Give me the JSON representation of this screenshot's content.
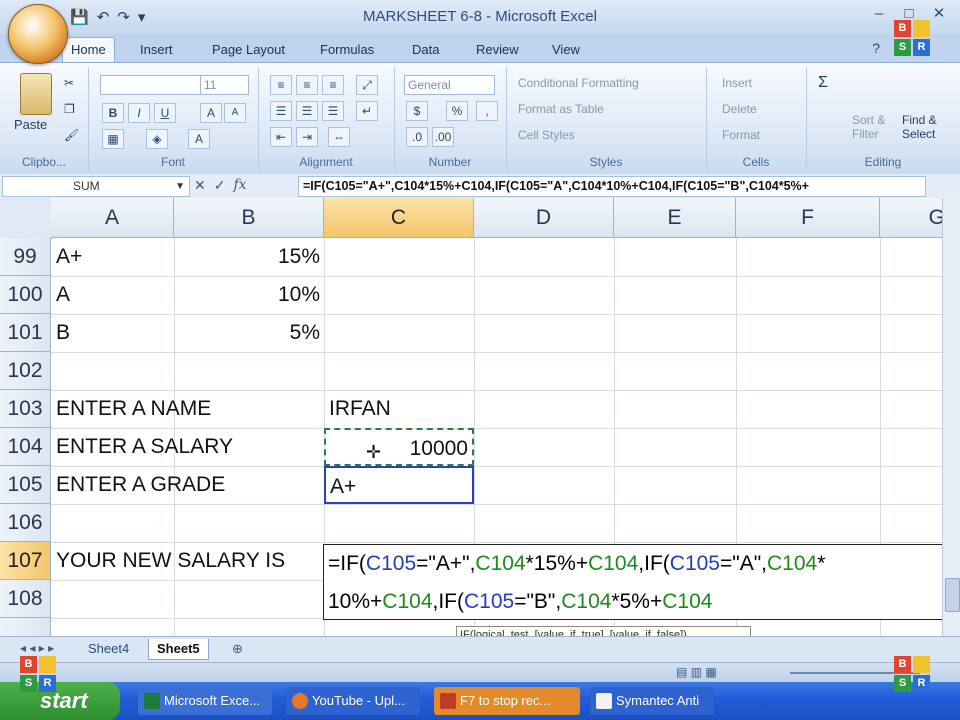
{
  "window": {
    "title": "MARKSHEET 6-8 - Microsoft Excel"
  },
  "ribbon_tabs": [
    "Home",
    "Insert",
    "Page Layout",
    "Formulas",
    "Data",
    "Review",
    "View"
  ],
  "ribbon": {
    "clipboard": {
      "paste_label": "Paste",
      "group_label": "Clipbo..."
    },
    "font": {
      "size": "11",
      "group_label": "Font"
    },
    "alignment": {
      "group_label": "Alignment"
    },
    "number": {
      "format": "General",
      "dollar": "$",
      "percent": "%",
      "comma": ",",
      "group_label": "Number"
    },
    "styles": {
      "conditional": "Conditional Formatting",
      "format_table": "Format as Table",
      "cell_styles": "Cell Styles",
      "group_label": "Styles"
    },
    "cells": {
      "insert": "Insert",
      "delete": "Delete",
      "format": "Format",
      "group_label": "Cells"
    },
    "editing": {
      "sigma": "Σ",
      "sort": "Sort & Filter",
      "find": "Find & Select",
      "group_label": "Editing"
    }
  },
  "formula_bar": {
    "name_box": "SUM",
    "formula": "=IF(C105=\"A+\",C104*15%+C104,IF(C105=\"A\",C104*10%+C104,IF(C105=\"B\",C104*5%+"
  },
  "grid": {
    "columns": [
      "A",
      "B",
      "C",
      "D",
      "E",
      "F",
      "G"
    ],
    "rows": [
      {
        "num": "99",
        "a": "A+",
        "b": "15%",
        "c": ""
      },
      {
        "num": "100",
        "a": "A",
        "b": "10%",
        "c": ""
      },
      {
        "num": "101",
        "a": "B",
        "b": "5%",
        "c": ""
      },
      {
        "num": "102",
        "a": "",
        "b": "",
        "c": ""
      },
      {
        "num": "103",
        "a": "ENTER A NAME",
        "b": "",
        "c": "IRFAN"
      },
      {
        "num": "104",
        "a": "ENTER A SALARY",
        "b": "",
        "c": "10000"
      },
      {
        "num": "105",
        "a": "ENTER A GRADE",
        "b": "",
        "c": "A+"
      },
      {
        "num": "106",
        "a": "",
        "b": "",
        "c": ""
      },
      {
        "num": "107",
        "a": "YOUR NEW SALARY IS",
        "b": "",
        "c": ""
      },
      {
        "num": "108",
        "a": "",
        "b": "",
        "c": ""
      }
    ],
    "editing_cell": {
      "line1": [
        "=IF(",
        "C105",
        "=\"A+\",",
        "C104",
        "*15%+",
        "C104",
        ",IF(",
        "C105",
        "=\"A\",",
        "C104",
        "*"
      ],
      "line2": [
        "10%+",
        "C104",
        ",IF(",
        "C105",
        "=\"B\",",
        "C104",
        "*5%+",
        "C104"
      ]
    },
    "tooltip": "IF(logical_test, [value_if_true], [value_if_false])"
  },
  "sheets": {
    "tabs": [
      "Sheet4",
      "Sheet5"
    ],
    "active": "Sheet5"
  },
  "taskbar": {
    "start": "start",
    "items": [
      "Microsoft Exce...",
      "YouTube - Upl...",
      "F7 to stop rec...",
      "Symantec Anti"
    ]
  },
  "colors": {
    "ref_blue": "#1f3fbf",
    "ref_green": "#1e8a1e",
    "ref_purple": "#7a2c9e",
    "selection": "#f4c56b"
  }
}
